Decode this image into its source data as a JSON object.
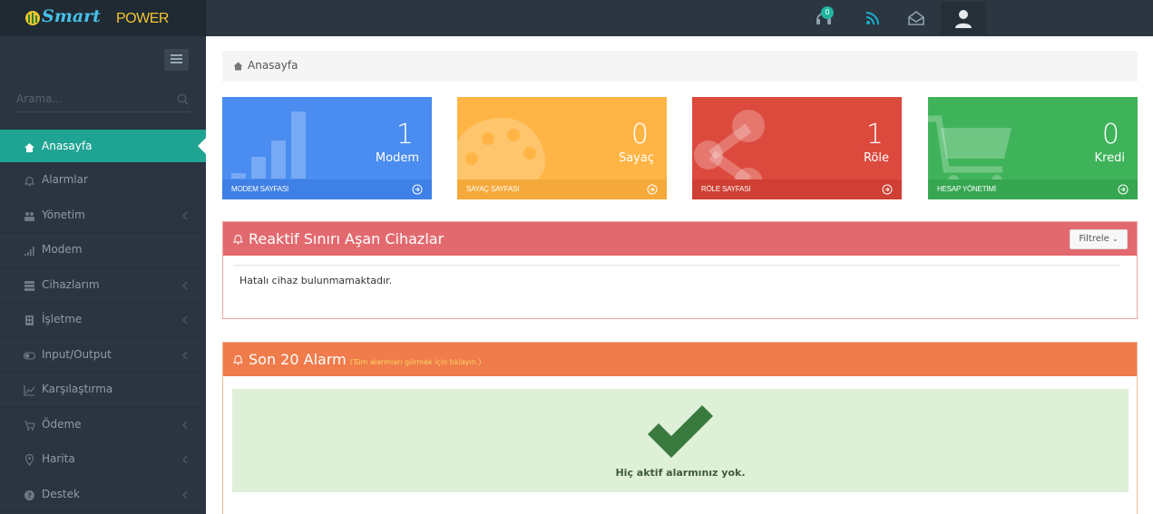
{
  "header": {
    "logo_smart": "Smart",
    "logo_power": "POWER",
    "notification_count": "0"
  },
  "sidebar": {
    "search_placeholder": "Arama...",
    "items": [
      {
        "label": "Anasayfa",
        "icon": "home-icon",
        "active": true
      },
      {
        "label": "Alarmlar",
        "icon": "bell-icon"
      },
      {
        "label": "Yönetim",
        "icon": "users-icon",
        "has_children": true
      },
      {
        "label": "Modem",
        "icon": "signal-icon"
      },
      {
        "label": "Cihazlarım",
        "icon": "server-icon",
        "has_children": true
      },
      {
        "label": "İşletme",
        "icon": "building-icon",
        "has_children": true
      },
      {
        "label": "Input/Output",
        "icon": "toggle-icon",
        "has_children": true
      },
      {
        "label": "Karşılaştırma",
        "icon": "chart-icon"
      },
      {
        "label": "Ödeme",
        "icon": "cart-icon",
        "has_children": true
      },
      {
        "label": "Harita",
        "icon": "map-pin-icon",
        "has_children": true
      },
      {
        "label": "Destek",
        "icon": "help-icon",
        "has_children": true
      }
    ]
  },
  "breadcrumb": {
    "label": "Anasayfa"
  },
  "tiles": [
    {
      "value": "1",
      "label": "Modem",
      "footer": "MODEM SAYFASI",
      "color": "#4a8cf0",
      "foot_color": "#3f80e6"
    },
    {
      "value": "0",
      "label": "Sayaç",
      "footer": "SAYAÇ SAYFASI",
      "color": "#ffb545",
      "foot_color": "#f5a93a"
    },
    {
      "value": "1",
      "label": "Röle",
      "footer": "RÖLE SAYFASI",
      "color": "#dc4a3e",
      "foot_color": "#cf3f33"
    },
    {
      "value": "0",
      "label": "Kredi",
      "footer": "HESAP YÖNETİMİ",
      "color": "#3fb35a",
      "foot_color": "#36a650"
    }
  ],
  "panels": {
    "reactive": {
      "title": "Reaktif Sınırı Aşan Cihazlar",
      "filter_label": "Filtrele",
      "message": "Hatalı cihaz bulunmamaktadır."
    },
    "alarms": {
      "title": "Son 20 Alarm",
      "subtitle": "(Tüm alarmları görmek için tıklayın.)",
      "message": "Hiç aktif alarmınız yok."
    }
  },
  "colors": {
    "sidebar_bg": "#2a3541",
    "active_item": "#1fa493",
    "panel_red": "#e26a6f",
    "panel_orange": "#f07b4b",
    "success_bg": "#dff0d8",
    "check_color": "#3c763d"
  }
}
